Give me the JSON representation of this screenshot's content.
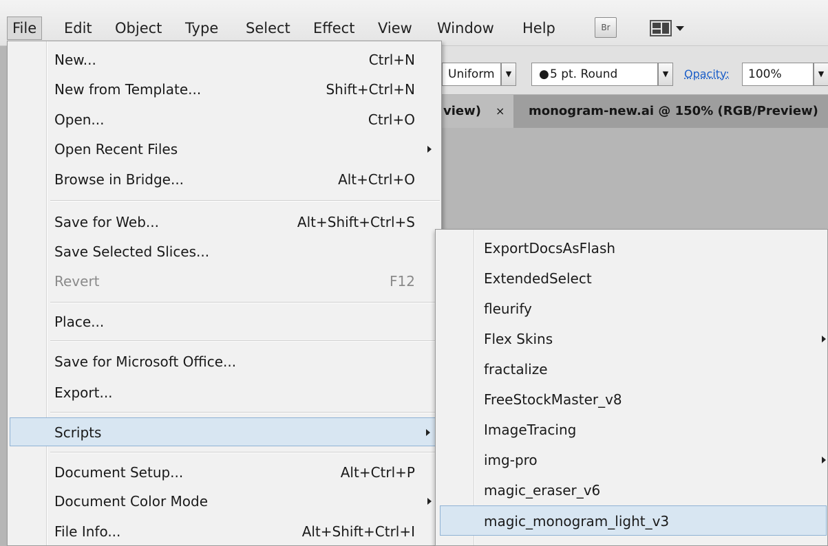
{
  "menubar": {
    "items": [
      "File",
      "Edit",
      "Object",
      "Type",
      "Select",
      "Effect",
      "View",
      "Window",
      "Help"
    ],
    "bridge_icon_label": "Br"
  },
  "controlbar": {
    "profile_value": "Uniform",
    "brush_value": "5 pt. Round",
    "opacity_label": "Opacity:",
    "opacity_value": "100%"
  },
  "tabs": {
    "prev_tab_fragment": "view)",
    "prev_tab_close": "×",
    "active_tab": "monogram-new.ai @ 150% (RGB/Preview)"
  },
  "file_menu": {
    "items": [
      {
        "label": "New...",
        "shortcut": "Ctrl+N"
      },
      {
        "label": "New from Template...",
        "shortcut": "Shift+Ctrl+N"
      },
      {
        "label": "Open...",
        "shortcut": "Ctrl+O"
      },
      {
        "label": "Open Recent Files",
        "shortcut": ""
      },
      {
        "label": "Browse in Bridge...",
        "shortcut": "Alt+Ctrl+O"
      },
      {
        "label": "Save for Web...",
        "shortcut": "Alt+Shift+Ctrl+S"
      },
      {
        "label": "Save Selected Slices...",
        "shortcut": ""
      },
      {
        "label": "Revert",
        "shortcut": "F12"
      },
      {
        "label": "Place...",
        "shortcut": ""
      },
      {
        "label": "Save for Microsoft Office...",
        "shortcut": ""
      },
      {
        "label": "Export...",
        "shortcut": ""
      },
      {
        "label": "Scripts",
        "shortcut": ""
      },
      {
        "label": "Document Setup...",
        "shortcut": "Alt+Ctrl+P"
      },
      {
        "label": "Document Color Mode",
        "shortcut": ""
      },
      {
        "label": "File Info...",
        "shortcut": "Alt+Shift+Ctrl+I"
      }
    ]
  },
  "scripts_menu": {
    "items": [
      "ExportDocsAsFlash",
      "ExtendedSelect",
      "fleurify",
      "Flex Skins",
      "fractalize",
      "FreeStockMaster_v8",
      "ImageTracing",
      "img-pro",
      "magic_eraser_v6",
      "magic_monogram_light_v3"
    ]
  }
}
